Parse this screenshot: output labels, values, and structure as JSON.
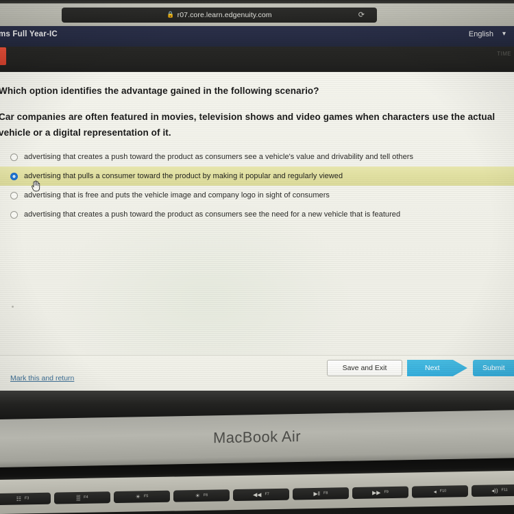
{
  "browser": {
    "url": "r07.core.learn.edgenuity.com",
    "lock_icon": "lock-icon",
    "reload_icon": "reload-icon"
  },
  "app_header": {
    "course_title": "ms Full Year-IC",
    "language_label": "English",
    "language_caret": "chevron-down-icon"
  },
  "subbar": {
    "timer_label": "TIME"
  },
  "question": {
    "stem": "Which option identifies the advantage gained in the following scenario?",
    "scenario": "Car companies are often featured in movies, television shows and video games when characters use the actual vehicle or a digital representation of it.",
    "options": [
      {
        "label": "advertising that creates a push toward the product as consumers see a vehicle's value and drivability and tell others",
        "selected": false
      },
      {
        "label": "advertising that pulls a consumer toward the product by making it popular and regularly viewed",
        "selected": true
      },
      {
        "label": "advertising that is free and puts the vehicle image and company logo in sight of consumers",
        "selected": false
      },
      {
        "label": "advertising that creates a push toward the product as consumers see the need for a new vehicle that is featured",
        "selected": false
      }
    ]
  },
  "footer": {
    "mark_return_label": "Mark this and return",
    "save_exit_label": "Save and Exit",
    "next_label": "Next",
    "submit_label": "Submit"
  },
  "device": {
    "model_label": "MacBook Air",
    "function_keys": [
      {
        "glyph": "☷",
        "fnum": "F3"
      },
      {
        "glyph": "▒",
        "fnum": "F4"
      },
      {
        "glyph": "☀",
        "fnum": "F5"
      },
      {
        "glyph": "☀",
        "fnum": "F6"
      },
      {
        "glyph": "◀◀",
        "fnum": "F7"
      },
      {
        "glyph": "▶‖",
        "fnum": "F8"
      },
      {
        "glyph": "▶▶",
        "fnum": "F9"
      },
      {
        "glyph": "◂",
        "fnum": "F10"
      },
      {
        "glyph": "◂))",
        "fnum": "F11"
      }
    ]
  },
  "colors": {
    "header_navy": "#272c44",
    "subbar_dark": "#232321",
    "page_bg": "#f1f1e9",
    "highlight_yellow": "#e2e1a2",
    "radio_selected": "#1974d2",
    "button_cyan": "#35addb",
    "link_blue": "#3d6f96",
    "red_tab": "#d3402c"
  }
}
